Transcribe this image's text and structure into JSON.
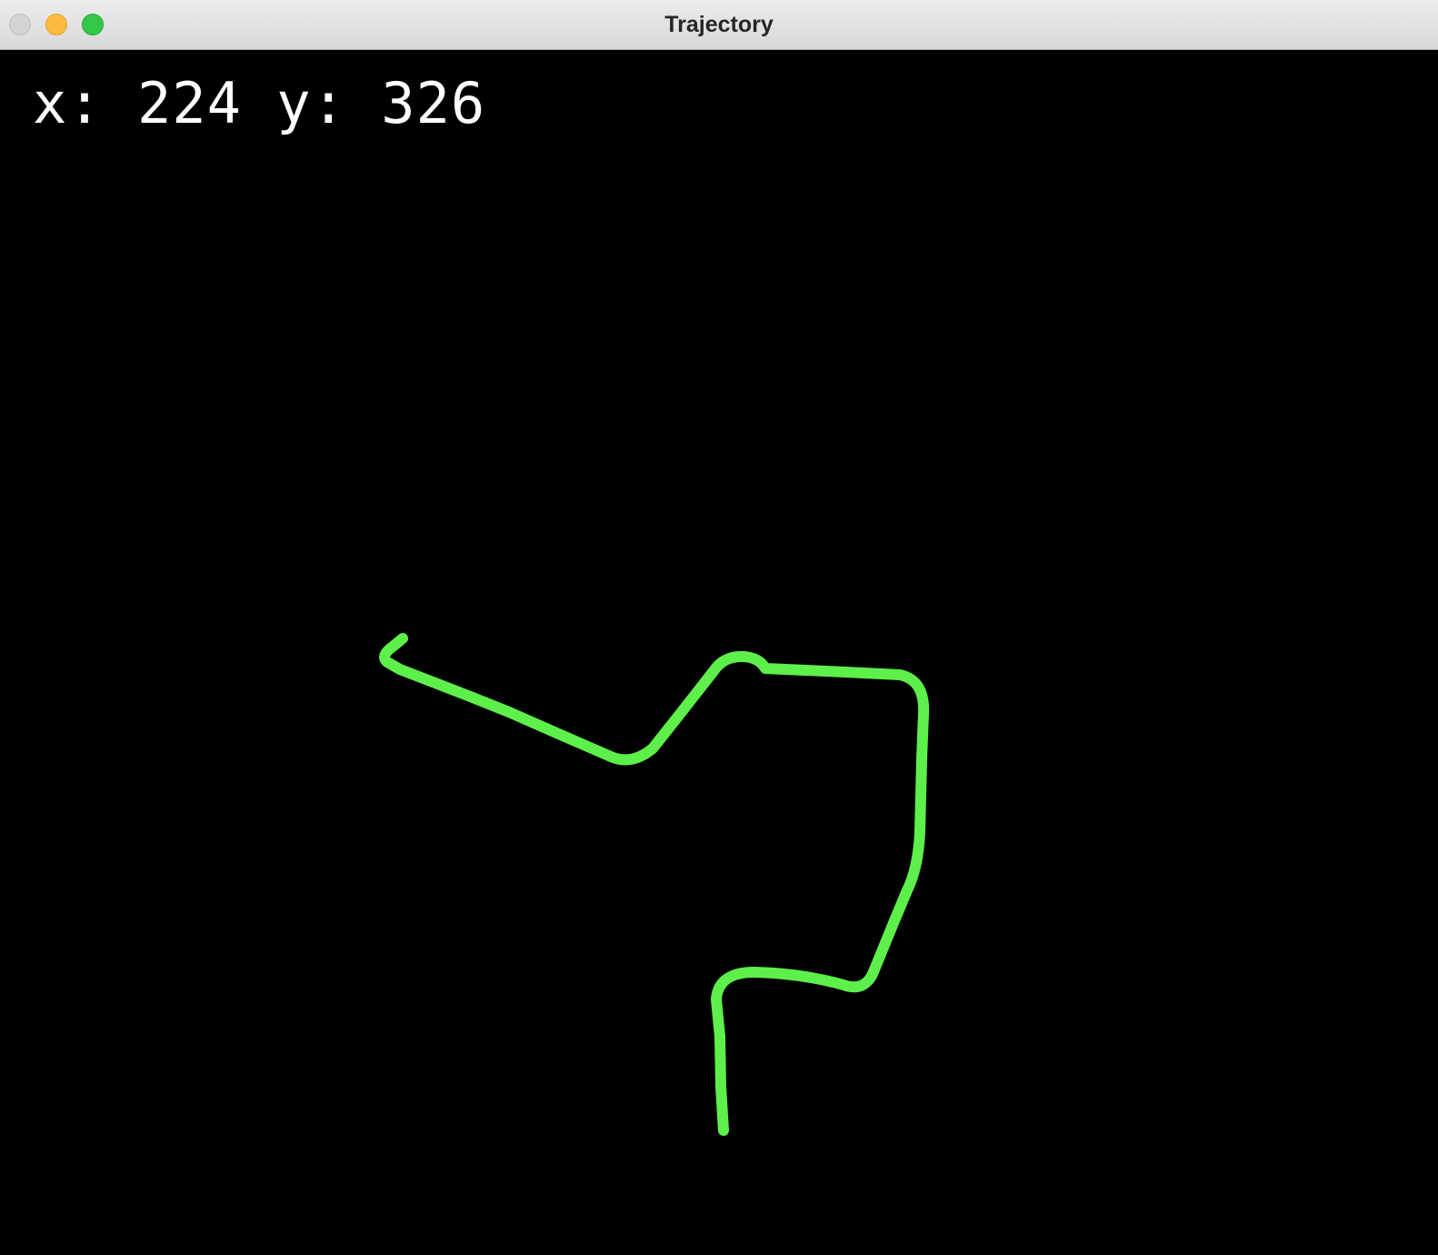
{
  "window": {
    "title": "Trajectory"
  },
  "readout": {
    "x_label": "x:",
    "x_value": "224",
    "y_label": "y:",
    "y_value": "326"
  },
  "colors": {
    "background": "#000000",
    "trajectory": "#5ef04a",
    "text": "#ffffff"
  }
}
